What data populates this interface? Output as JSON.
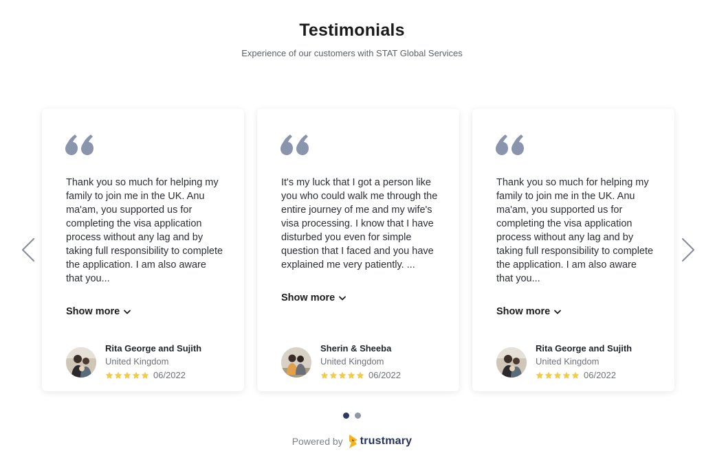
{
  "header": {
    "title": "Testimonials",
    "subtitle": "Experience of our customers with STAT Global Services"
  },
  "colors": {
    "quote_icon": "#8a94ad",
    "star": "#f7c948",
    "arrow": "#8a8f99",
    "dot_active": "#2b3a63",
    "dot_inactive": "#8f96a6",
    "brand": "#273358",
    "brand_logo": "#f5b21b"
  },
  "icons": {
    "quote": "quote-icon",
    "prev": "chevron-left-icon",
    "next": "chevron-right-icon",
    "show_more": "chevron-down-icon",
    "star": "star-icon",
    "brand": "trustmary-logo-icon"
  },
  "testimonials": [
    {
      "text": "Thank you so much for helping my family to join me in the UK. Anu ma'am, you supported us for completing the visa application process without any lag and by taking full responsibility to complete the application. I am also aware that you...",
      "show_more": "Show more",
      "name": "Rita George and Sujith",
      "country": "United Kingdom",
      "rating": 5,
      "date": "06/2022"
    },
    {
      "text": "It's my luck that I got a person like you who could walk me through the entire journey of me and my wife's visa processing. I know that I have disturbed you even for simple question that I faced and you have explained me very patiently. ...",
      "show_more": "Show more",
      "name": "Sherin & Sheeba",
      "country": "United Kingdom",
      "rating": 5,
      "date": "06/2022"
    },
    {
      "text": "Thank you so much for helping my family to join me in the UK. Anu ma'am, you supported us for completing the visa application process without any lag and by taking full responsibility to complete the application. I am also aware that you...",
      "show_more": "Show more",
      "name": "Rita George and Sujith",
      "country": "United Kingdom",
      "rating": 5,
      "date": "06/2022"
    }
  ],
  "pagination": {
    "pages": 2,
    "current": 1
  },
  "footer": {
    "powered_label": "Powered by",
    "brand_name": "trustmary"
  }
}
